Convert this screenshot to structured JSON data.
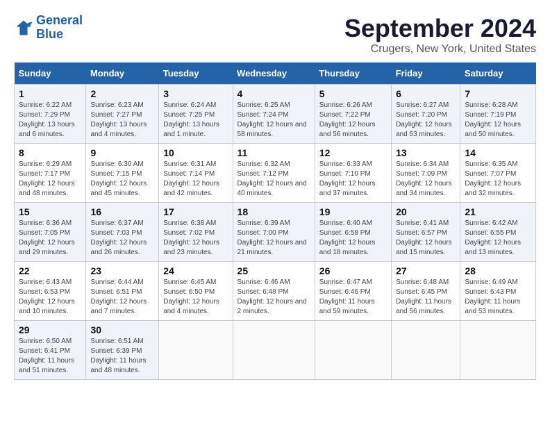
{
  "header": {
    "logo_line1": "General",
    "logo_line2": "Blue",
    "title": "September 2024",
    "subtitle": "Crugers, New York, United States"
  },
  "columns": [
    "Sunday",
    "Monday",
    "Tuesday",
    "Wednesday",
    "Thursday",
    "Friday",
    "Saturday"
  ],
  "rows": [
    [
      {
        "day": "1",
        "info": "Sunrise: 6:22 AM\nSunset: 7:29 PM\nDaylight: 13 hours and 6 minutes."
      },
      {
        "day": "2",
        "info": "Sunrise: 6:23 AM\nSunset: 7:27 PM\nDaylight: 13 hours and 4 minutes."
      },
      {
        "day": "3",
        "info": "Sunrise: 6:24 AM\nSunset: 7:25 PM\nDaylight: 13 hours and 1 minute."
      },
      {
        "day": "4",
        "info": "Sunrise: 6:25 AM\nSunset: 7:24 PM\nDaylight: 12 hours and 58 minutes."
      },
      {
        "day": "5",
        "info": "Sunrise: 6:26 AM\nSunset: 7:22 PM\nDaylight: 12 hours and 56 minutes."
      },
      {
        "day": "6",
        "info": "Sunrise: 6:27 AM\nSunset: 7:20 PM\nDaylight: 12 hours and 53 minutes."
      },
      {
        "day": "7",
        "info": "Sunrise: 6:28 AM\nSunset: 7:19 PM\nDaylight: 12 hours and 50 minutes."
      }
    ],
    [
      {
        "day": "8",
        "info": "Sunrise: 6:29 AM\nSunset: 7:17 PM\nDaylight: 12 hours and 48 minutes."
      },
      {
        "day": "9",
        "info": "Sunrise: 6:30 AM\nSunset: 7:15 PM\nDaylight: 12 hours and 45 minutes."
      },
      {
        "day": "10",
        "info": "Sunrise: 6:31 AM\nSunset: 7:14 PM\nDaylight: 12 hours and 42 minutes."
      },
      {
        "day": "11",
        "info": "Sunrise: 6:32 AM\nSunset: 7:12 PM\nDaylight: 12 hours and 40 minutes."
      },
      {
        "day": "12",
        "info": "Sunrise: 6:33 AM\nSunset: 7:10 PM\nDaylight: 12 hours and 37 minutes."
      },
      {
        "day": "13",
        "info": "Sunrise: 6:34 AM\nSunset: 7:09 PM\nDaylight: 12 hours and 34 minutes."
      },
      {
        "day": "14",
        "info": "Sunrise: 6:35 AM\nSunset: 7:07 PM\nDaylight: 12 hours and 32 minutes."
      }
    ],
    [
      {
        "day": "15",
        "info": "Sunrise: 6:36 AM\nSunset: 7:05 PM\nDaylight: 12 hours and 29 minutes."
      },
      {
        "day": "16",
        "info": "Sunrise: 6:37 AM\nSunset: 7:03 PM\nDaylight: 12 hours and 26 minutes."
      },
      {
        "day": "17",
        "info": "Sunrise: 6:38 AM\nSunset: 7:02 PM\nDaylight: 12 hours and 23 minutes."
      },
      {
        "day": "18",
        "info": "Sunrise: 6:39 AM\nSunset: 7:00 PM\nDaylight: 12 hours and 21 minutes."
      },
      {
        "day": "19",
        "info": "Sunrise: 6:40 AM\nSunset: 6:58 PM\nDaylight: 12 hours and 18 minutes."
      },
      {
        "day": "20",
        "info": "Sunrise: 6:41 AM\nSunset: 6:57 PM\nDaylight: 12 hours and 15 minutes."
      },
      {
        "day": "21",
        "info": "Sunrise: 6:42 AM\nSunset: 6:55 PM\nDaylight: 12 hours and 13 minutes."
      }
    ],
    [
      {
        "day": "22",
        "info": "Sunrise: 6:43 AM\nSunset: 6:53 PM\nDaylight: 12 hours and 10 minutes."
      },
      {
        "day": "23",
        "info": "Sunrise: 6:44 AM\nSunset: 6:51 PM\nDaylight: 12 hours and 7 minutes."
      },
      {
        "day": "24",
        "info": "Sunrise: 6:45 AM\nSunset: 6:50 PM\nDaylight: 12 hours and 4 minutes."
      },
      {
        "day": "25",
        "info": "Sunrise: 6:46 AM\nSunset: 6:48 PM\nDaylight: 12 hours and 2 minutes."
      },
      {
        "day": "26",
        "info": "Sunrise: 6:47 AM\nSunset: 6:46 PM\nDaylight: 11 hours and 59 minutes."
      },
      {
        "day": "27",
        "info": "Sunrise: 6:48 AM\nSunset: 6:45 PM\nDaylight: 11 hours and 56 minutes."
      },
      {
        "day": "28",
        "info": "Sunrise: 6:49 AM\nSunset: 6:43 PM\nDaylight: 11 hours and 53 minutes."
      }
    ],
    [
      {
        "day": "29",
        "info": "Sunrise: 6:50 AM\nSunset: 6:41 PM\nDaylight: 11 hours and 51 minutes."
      },
      {
        "day": "30",
        "info": "Sunrise: 6:51 AM\nSunset: 6:39 PM\nDaylight: 11 hours and 48 minutes."
      },
      {
        "day": "",
        "info": ""
      },
      {
        "day": "",
        "info": ""
      },
      {
        "day": "",
        "info": ""
      },
      {
        "day": "",
        "info": ""
      },
      {
        "day": "",
        "info": ""
      }
    ]
  ]
}
